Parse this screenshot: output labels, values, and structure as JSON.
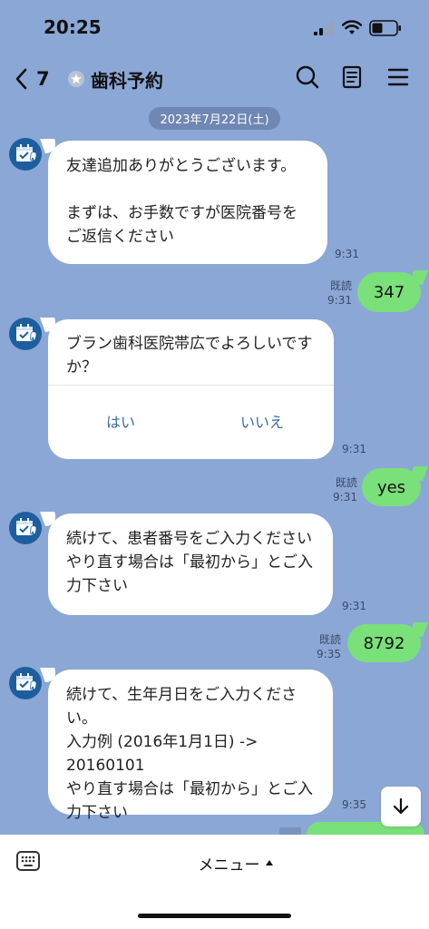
{
  "status_bar": {
    "time": "20:25"
  },
  "header": {
    "back_count": "7",
    "title": "歯科予約"
  },
  "date_pill": "2023年7月22日(土)",
  "messages": [
    {
      "text": "友達追加ありがとうございます。\n\nまずは、お手数ですが医院番号を\nご返信ください",
      "time": "9:31"
    },
    {
      "text": "347",
      "read": "既読",
      "time": "9:31"
    },
    {
      "question": "ブラン歯科医院帯広でよろしいですか？",
      "yes": "はい",
      "no": "いいえ",
      "time": "9:31"
    },
    {
      "text": "yes",
      "read": "既読",
      "time": "9:31"
    },
    {
      "text": "続けて、患者番号をご入力ください\nやり直す場合は「最初から」とご入力下さい",
      "time": "9:31"
    },
    {
      "text": "8792",
      "read": "既読",
      "time": "9:35"
    },
    {
      "text": "続けて、生年月日をご入力ください。\n入力例 (2016年1月1日) ->\n20160101\nやり直す場合は「最初から」とご入力下さい",
      "time": "9:35"
    }
  ],
  "bottom": {
    "menu_label": "メニュー"
  },
  "colors": {
    "background": "#8aa7d6",
    "outgoing": "#7ae07a",
    "incoming": "#ffffff",
    "avatar": "#1d5f9e"
  },
  "icons": [
    "signal-icon",
    "wifi-icon",
    "battery-icon",
    "back-chevron-icon",
    "shield-icon",
    "search-icon",
    "notes-icon",
    "menu-icon",
    "calendar-tooth-icon",
    "arrow-down-icon",
    "keyboard-icon",
    "triangle-up-icon"
  ]
}
